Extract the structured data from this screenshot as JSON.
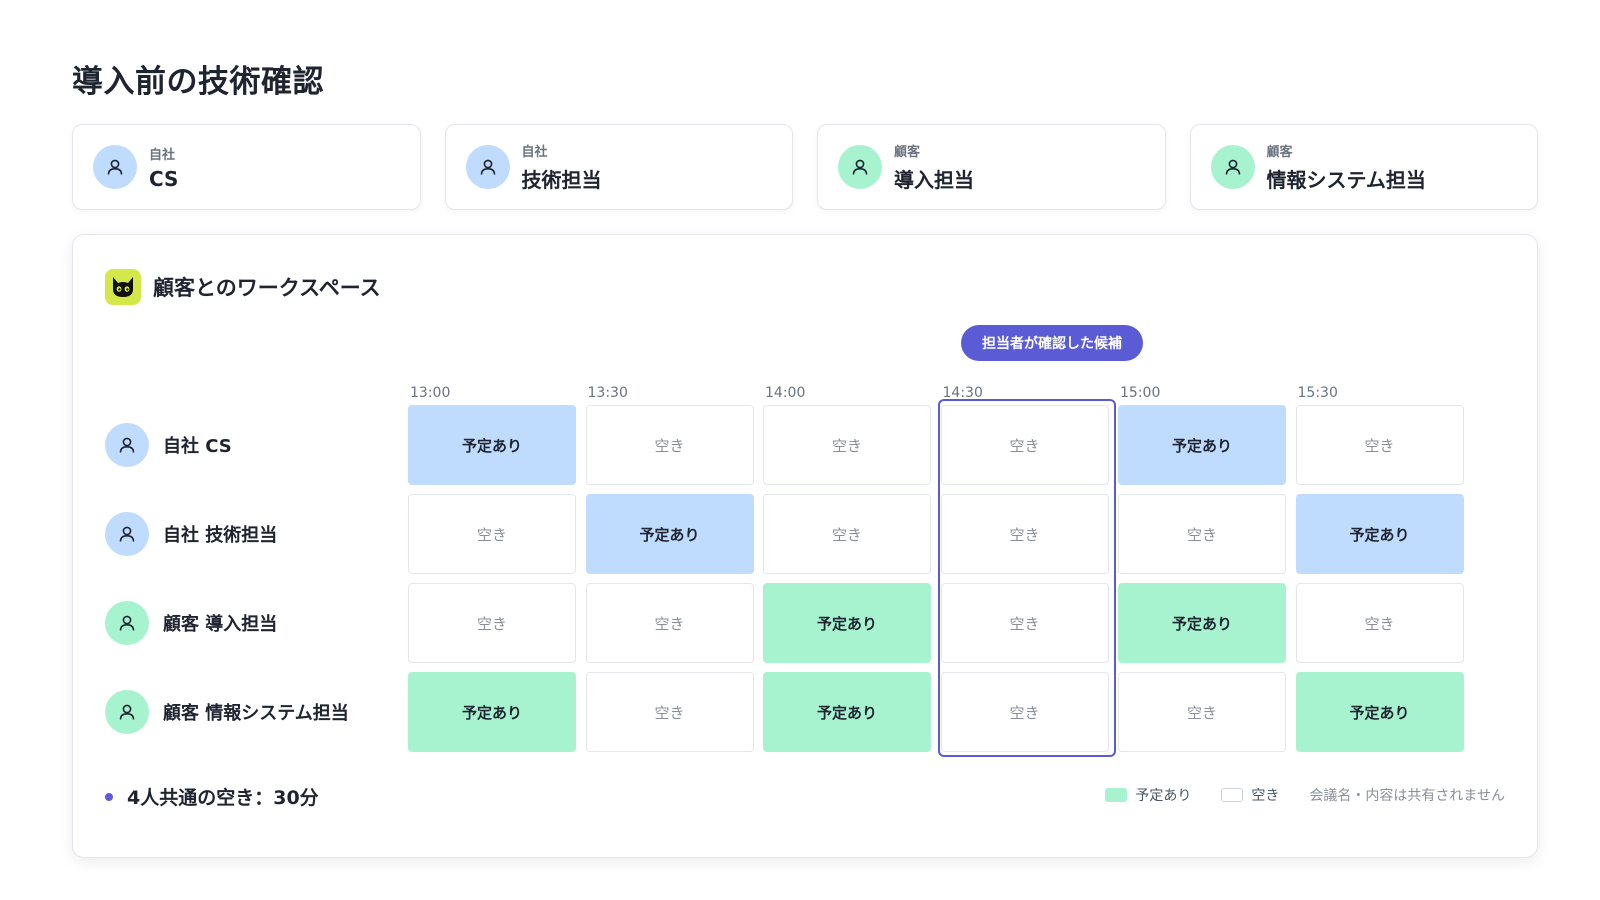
{
  "page": {
    "title": "導入前の技術確認"
  },
  "participants": [
    {
      "org": "自社",
      "role": "CS",
      "color": "blue"
    },
    {
      "org": "自社",
      "role": "技術担当",
      "color": "blue"
    },
    {
      "org": "顧客",
      "role": "導入担当",
      "color": "green"
    },
    {
      "org": "顧客",
      "role": "情報システム担当",
      "color": "green"
    }
  ],
  "workspace": {
    "title": "顧客とのワークスペース",
    "logo_icon": "cat-icon",
    "candidate_badge": "担当者が確認した候補",
    "times": [
      "13:00",
      "13:30",
      "14:00",
      "14:30",
      "15:00",
      "15:30"
    ],
    "rows": [
      {
        "label": "自社 CS",
        "color": "blue",
        "slots": [
          "予定あり",
          "空き",
          "空き",
          "空き",
          "予定あり",
          "空き"
        ]
      },
      {
        "label": "自社 技術担当",
        "color": "blue",
        "slots": [
          "空き",
          "予定あり",
          "空き",
          "空き",
          "空き",
          "予定あり"
        ]
      },
      {
        "label": "顧客 導入担当",
        "color": "green",
        "slots": [
          "空き",
          "空き",
          "予定あり",
          "空き",
          "予定あり",
          "空き"
        ]
      },
      {
        "label": "顧客 情報システム担当",
        "color": "green",
        "slots": [
          "予定あり",
          "空き",
          "予定あり",
          "空き",
          "空き",
          "予定あり"
        ]
      }
    ],
    "candidate_column_index": 3,
    "footer": {
      "common_free": "4人共通の空き：30分",
      "legend_busy": "予定あり",
      "legend_free": "空き",
      "privacy_note": "会議名・内容は共有されません"
    }
  },
  "colors": {
    "accent": "#5b5bd6",
    "busy_blue": "#bfdbfe",
    "busy_green": "#a7f3d0",
    "logo_bg": "#d4e84a"
  }
}
